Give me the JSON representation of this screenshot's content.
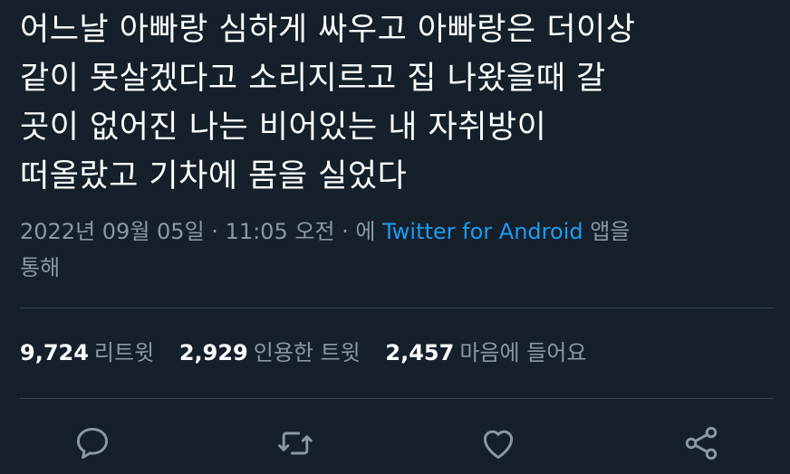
{
  "tweet": {
    "text_lines": [
      "어느날 아빠랑 심하게 싸우고 아빠랑은 더이상",
      "같이 못살겠다고 소리지르고 집 나왔을때 갈",
      "곳이 없어진 나는 비어있는 내 자취방이",
      "떠올랐고 기차에 몸을 실었다"
    ],
    "date": "2022년 09월 05일",
    "separator": " · ",
    "time": "11:05 오전",
    "source_prefix": "에 ",
    "source": "Twitter for Android",
    "source_suffix": " 앱을",
    "source_suffix2": "통해"
  },
  "stats": {
    "retweets_count": "9,724",
    "retweets_label": "리트윗",
    "quotes_count": "2,929",
    "quotes_label": "인용한 트윗",
    "likes_count": "2,457",
    "likes_label": "마음에 들어요"
  },
  "actions": {
    "icons": [
      "reply-icon",
      "retweet-icon",
      "like-icon",
      "share-icon"
    ],
    "icon_color": "#8b98a5"
  },
  "colors": {
    "background": "#15202b",
    "text": "#ffffff",
    "muted": "#8b98a5",
    "link": "#1d9bf0",
    "divider": "#38444d"
  }
}
